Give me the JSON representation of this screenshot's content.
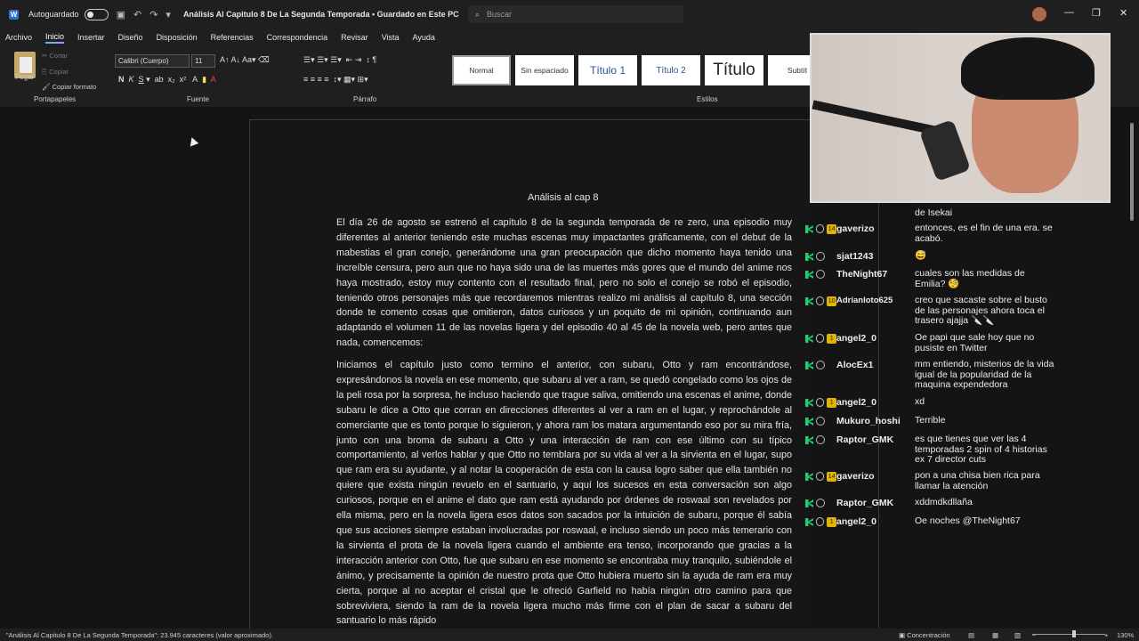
{
  "title_bar": {
    "app_logo": "W",
    "autosave_label": "Autoguardado",
    "autosave_state": "off",
    "document_title": "Análisis Al Capitulo 8 De La Segunda Temporada • Guardado en Este PC",
    "search_placeholder": "Buscar"
  },
  "menu": [
    "Archivo",
    "Inicio",
    "Insertar",
    "Diseño",
    "Disposición",
    "Referencias",
    "Correspondencia",
    "Revisar",
    "Vista",
    "Ayuda"
  ],
  "ribbon": {
    "clipboard": {
      "paste": "Pegar",
      "cut": "Cortar",
      "copy": "Copiar",
      "format_painter": "Copiar formato",
      "label": "Portapapeles"
    },
    "font": {
      "family": "Calibri (Cuerpo)",
      "size": "11",
      "label": "Fuente"
    },
    "paragraph_label": "Párrafo",
    "styles": [
      "Normal",
      "Sin espaciado",
      "Título 1",
      "Título 2",
      "Título",
      "Subtít"
    ],
    "styles_label": "Estilos"
  },
  "document": {
    "heading": "Análisis al cap 8",
    "paragraph1": "El día 26 de agosto se estrenó el capítulo 8 de la segunda temporada de re zero, una episodio muy diferentes al anterior teniendo este muchas escenas muy impactantes gráficamente, con el debut de la mabestias el gran conejo, generándome una gran preocupación que dicho momento haya tenido una increíble censura, pero aun que no haya sido una de las muertes más gores que el mundo del anime nos haya mostrado, estoy muy contento con el resultado final, pero no solo el conejo se robó el episodio, teniendo otros personajes más que recordaremos mientras realizo mi análisis al capítulo 8, una sección donde te comento cosas que omitieron, datos curiosos y un poquito de mi opinión, continuando aun adaptando el volumen 11 de las novelas ligera y del episodio 40 al 45 de la novela web, pero antes que nada, comencemos:",
    "paragraph2": "Iniciamos el capítulo justo como termino el anterior, con subaru, Otto y ram encontrándose, expresándonos la novela en ese momento, que subaru al ver a ram, se quedó congelado como los ojos de la peli rosa por la sorpresa, he incluso haciendo que trague saliva, omitiendo una escenas el anime, donde subaru le dice a Otto que corran en direcciones diferentes al ver a ram en el lugar, y reprochándole al comerciante que es tonto porque lo siguieron, y ahora ram los matara argumentando eso por su mira fría, junto con una broma de subaru a Otto y una interacción de ram con ese último con su típico comportamiento, al verlos hablar y que Otto no temblara por su vida al ver a la sirvienta en el lugar, supo que ram era su ayudante, y al notar la cooperación de esta con la causa logro saber que ella también no quiere que exista ningún revuelo en el santuario, y aquí los sucesos en esta conversación son algo curiosos, porque en el anime el dato que ram está ayudando por órdenes de roswaal son revelados por ella misma, pero en la novela ligera esos datos son sacados por la intuición de subaru, porque él sabía que sus acciones siempre estaban involucradas por roswaal, e incluso siendo un poco más temerario con la sirvienta el prota de la novela ligera cuando el ambiente era tenso, incorporando que gracias a la interacción anterior con Otto, fue que subaru en ese momento se encontraba muy tranquilo, subiéndole el ánimo, y precisamente la opinión de nuestro prota que Otto hubiera muerto sin la ayuda de ram era muy cierta, porque al no aceptar el cristal que le ofreció Garfield no había ningún otro camino para que sobreviviera, siendo la ram de la novela ligera mucho más firme con el plan de sacar a subaru del santuario lo más rápido"
  },
  "chat": [
    {
      "user": "",
      "badge": "",
      "msg": "de Isekai"
    },
    {
      "user": "gaverizo",
      "badge": "14",
      "msg": "entonces, es el fin de una era. se acabó."
    },
    {
      "user": "sjat1243",
      "badge": "",
      "msg": "😅"
    },
    {
      "user": "TheNight67",
      "badge": "",
      "msg": "cuales son las medidas de Emilia? 🧐"
    },
    {
      "user": "Adrianloto625",
      "badge": "10",
      "msg": "creo que sacaste sobre el busto de las personajes ahora toca el trasero ajajja 🔪🔪"
    },
    {
      "user": "angel2_0",
      "badge": "1",
      "msg": "Oe papi que sale hoy que no pusiste en Twitter"
    },
    {
      "user": "AlocEx1",
      "badge": "",
      "msg": "mm entiendo, misterios de la vida igual de la popularidad de la maquina expendedora"
    },
    {
      "user": "angel2_0",
      "badge": "1",
      "msg": "xd"
    },
    {
      "user": "Mukuro_hoshi",
      "badge": "",
      "msg": "Terrible"
    },
    {
      "user": "Raptor_GMK",
      "badge": "",
      "msg": "es que tienes que ver las 4 temporadas 2 spin of 4 historias ex 7 director cuts"
    },
    {
      "user": "gaverizo",
      "badge": "14",
      "msg": "pon a una chisa bien rica para llamar la atención"
    },
    {
      "user": "Raptor_GMK",
      "badge": "",
      "msg": "xddmdkdllaña"
    },
    {
      "user": "angel2_0",
      "badge": "1",
      "msg": "Oe noches @TheNight67"
    }
  ],
  "status_bar": {
    "left": "\"Análisis Al Capitulo 8 De La Segunda Temporada\": 23.945 caracteres (valor aproximado).",
    "focus": "Concentración",
    "zoom": "130%"
  },
  "colors": {
    "accent": "#7aa8ff",
    "chat_green": "#1ecf6b",
    "sub_badge": "#e0b400"
  }
}
